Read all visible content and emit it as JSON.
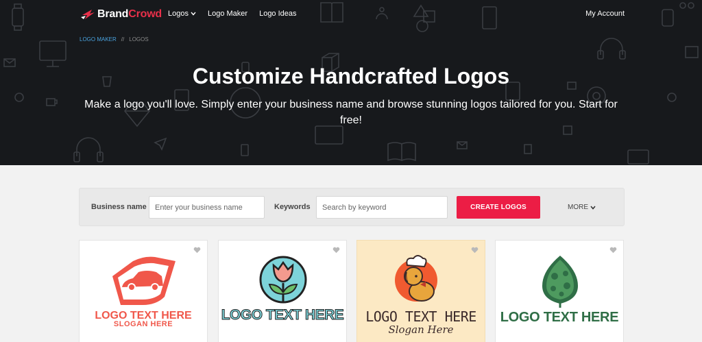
{
  "brand": {
    "name_part1": "Brand",
    "name_part2": "Crowd",
    "accent": "#e8304a"
  },
  "nav": {
    "items": [
      {
        "label": "Logos",
        "has_dropdown": true
      },
      {
        "label": "Logo Maker"
      },
      {
        "label": "Logo Ideas"
      }
    ],
    "account_label": "My Account"
  },
  "breadcrumb": {
    "parent": "LOGO MAKER",
    "separator": "//",
    "current": "LOGOS"
  },
  "hero": {
    "title": "Customize Handcrafted Logos",
    "subtitle": "Make a logo you'll love. Simply enter your business name and browse stunning logos tailored for you. Start for free!"
  },
  "search": {
    "business_label": "Business name",
    "business_placeholder": "Enter your business name",
    "keywords_label": "Keywords",
    "keywords_placeholder": "Search by keyword",
    "create_button": "CREATE LOGOS",
    "more_label": "MORE",
    "button_color": "#ec1d45"
  },
  "cards": [
    {
      "icon": "car-shield-icon",
      "line1": "LOGO TEXT HERE",
      "line2": "SLOGAN HERE",
      "color": "#f0574a"
    },
    {
      "icon": "tulip-icon",
      "line1": "LOGO TEXT HERE",
      "line2": "",
      "color": "#7dd3d9"
    },
    {
      "icon": "chef-dog-icon",
      "line1": "LOGO TEXT HERE",
      "line2": "Slogan Here",
      "color": "#3b2a2a"
    },
    {
      "icon": "leaf-icon",
      "line1": "LOGO TEXT HERE",
      "line2": "",
      "color": "#2f6e46"
    }
  ]
}
